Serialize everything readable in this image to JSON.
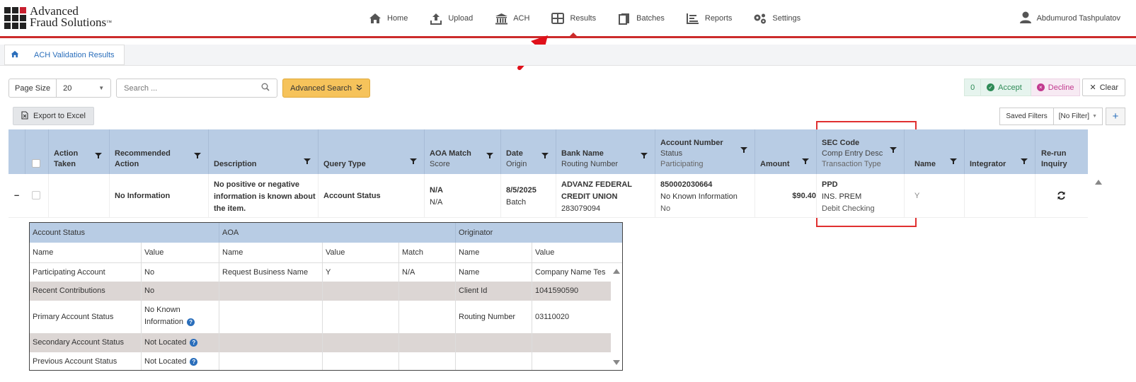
{
  "brand": {
    "line1": "Advanced",
    "line2": "Fraud Solutions",
    "tm": "™",
    "accent_color": "#cc2b2b"
  },
  "nav": {
    "items": [
      {
        "label": "Home",
        "icon": "home-icon"
      },
      {
        "label": "Upload",
        "icon": "upload-icon"
      },
      {
        "label": "ACH",
        "icon": "bank-icon"
      },
      {
        "label": "Results",
        "icon": "table-icon",
        "active": true
      },
      {
        "label": "Batches",
        "icon": "batches-icon"
      },
      {
        "label": "Reports",
        "icon": "reports-icon"
      },
      {
        "label": "Settings",
        "icon": "gears-icon"
      }
    ]
  },
  "user": {
    "name": "Abdumurod Tashpulatov"
  },
  "breadcrumb": {
    "current": "ACH Validation Results"
  },
  "toolbar": {
    "page_size_label": "Page Size",
    "page_size_value": "20",
    "search_placeholder": "Search ...",
    "advanced_search_label": "Advanced Search",
    "selected_count": "0",
    "accept_label": "Accept",
    "decline_label": "Decline",
    "clear_label": "Clear",
    "export_label": "Export to Excel",
    "saved_filters_label": "Saved Filters",
    "filter_value": "[No Filter]",
    "add_label": "+"
  },
  "grid": {
    "headers": {
      "action_taken": {
        "t1": "Action",
        "t2": "Taken"
      },
      "recommended_action": {
        "t1": "Recommended",
        "t2": "Action"
      },
      "description": "Description",
      "query_type": "Query Type",
      "aoa_match": {
        "t1": "AOA Match",
        "sub": "Score"
      },
      "date": {
        "t1": "Date",
        "sub": "Origin"
      },
      "bank_name": {
        "t1": "Bank Name",
        "sub": "Routing Number"
      },
      "account_number": {
        "t1": "Account Number",
        "sub1": "Status",
        "sub2": "Participating"
      },
      "amount": "Amount",
      "sec_code": {
        "t1": "SEC Code",
        "sub1": "Comp Entry Desc",
        "sub2": "Transaction Type"
      },
      "name": "Name",
      "integrator": "Integrator",
      "rerun": {
        "t1": "Re-run",
        "t2": "Inquiry"
      }
    },
    "row": {
      "expander": "–",
      "recommended_action": "No Information",
      "description": [
        "No positive or negative",
        "information is known about",
        "the item."
      ],
      "query_type": "Account Status",
      "aoa_match": "N/A",
      "aoa_score": "N/A",
      "date": "8/5/2025",
      "origin": "Batch",
      "bank_name_1": "ADVANZ FEDERAL",
      "bank_name_2": "CREDIT UNION",
      "routing_number": "283079094",
      "account_number": "850002030664",
      "status": "No Known Information",
      "participating": "No",
      "amount": "$90.40",
      "sec_code": "PPD",
      "comp_entry_desc": "INS. PREM",
      "transaction_type": "Debit Checking",
      "name_partial": "Y"
    }
  },
  "detail": {
    "groups": {
      "account_status": "Account Status",
      "aoa": "AOA",
      "originator": "Originator"
    },
    "sub_headers": {
      "name": "Name",
      "value": "Value",
      "match": "Match"
    },
    "rows": [
      {
        "as_name": "Participating Account",
        "as_value": "No",
        "aoa_name": "Request Business Name",
        "aoa_value": "Y",
        "aoa_match": "N/A",
        "orig_name": "Name",
        "orig_value": "Company Name Tes"
      },
      {
        "as_name": "Recent Contributions",
        "as_value": "No",
        "aoa_name": "",
        "aoa_value": "",
        "aoa_match": "",
        "orig_name": "Client Id",
        "orig_value": "1041590590"
      },
      {
        "as_name": "Primary Account Status",
        "as_value_1": "No Known",
        "as_value_2": "Information",
        "aoa_name": "",
        "aoa_value": "",
        "aoa_match": "",
        "orig_name": "Routing Number",
        "orig_value": "03110020"
      },
      {
        "as_name": "Secondary Account Status",
        "as_value": "Not Located",
        "aoa_name": "",
        "aoa_value": "",
        "aoa_match": "",
        "orig_name": "",
        "orig_value": ""
      },
      {
        "as_name": "Previous Account Status",
        "as_value": "Not Located",
        "aoa_name": "",
        "aoa_value": "",
        "aoa_match": "",
        "orig_name": "",
        "orig_value": ""
      }
    ],
    "info_glyph": "?"
  },
  "colors": {
    "header_blue": "#b8cce4",
    "shade_row": "#dcd6d4",
    "advanced_search": "#f6c35b",
    "accept_green": "#2e8b57",
    "decline_magenta": "#c23a8f",
    "annotation_red": "#e03030"
  }
}
